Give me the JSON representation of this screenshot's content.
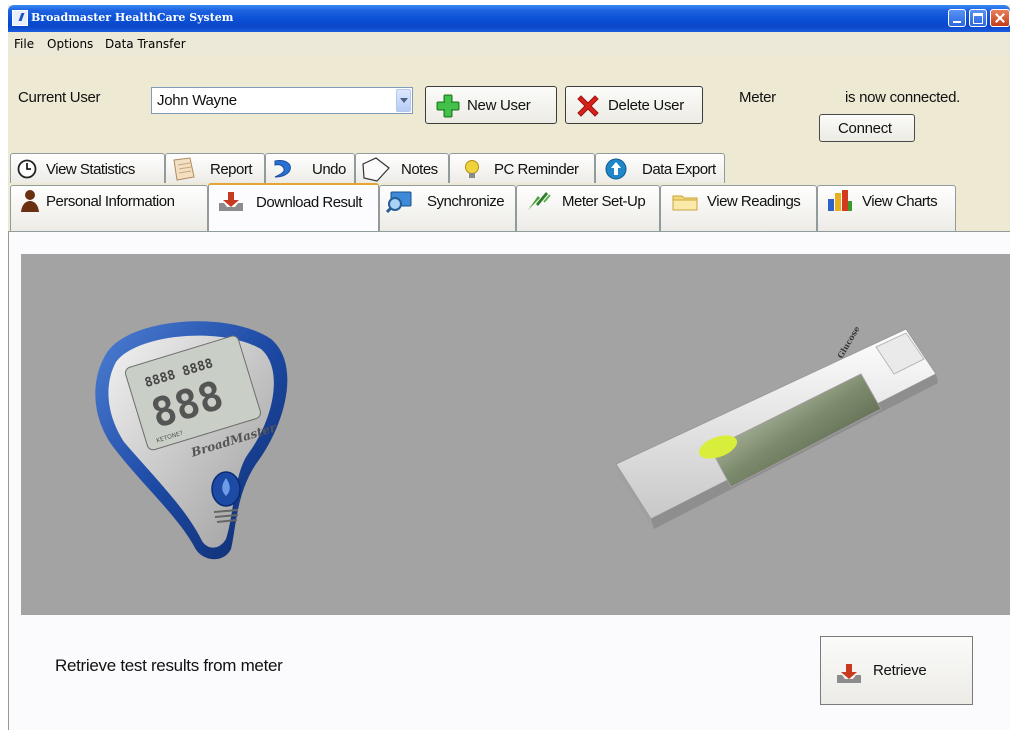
{
  "window": {
    "title": "Broadmaster HealthCare System"
  },
  "menu": [
    "File",
    "Options",
    "Data Transfer"
  ],
  "user_bar": {
    "current_user_label": "Current User",
    "current_user_value": "John Wayne",
    "new_user": "New User",
    "delete_user": "Delete User",
    "meter_label": "Meter",
    "meter_status": "is now connected.",
    "connect": "Connect"
  },
  "tabs_row1": [
    {
      "label": "View Statistics",
      "icon": "clock-icon"
    },
    {
      "label": "Report",
      "icon": "notepad-icon"
    },
    {
      "label": "Undo",
      "icon": "undo-arrow-icon"
    },
    {
      "label": "Notes",
      "icon": "note-page-icon"
    },
    {
      "label": "PC Reminder",
      "icon": "bulb-icon"
    },
    {
      "label": "Data Export",
      "icon": "export-globe-icon"
    }
  ],
  "tabs_row2": [
    {
      "label": "Personal Information",
      "icon": "person-icon"
    },
    {
      "label": "Download Result",
      "icon": "download-tray-icon",
      "active": true
    },
    {
      "label": "Synchronize",
      "icon": "monitor-search-icon"
    },
    {
      "label": "Meter Set-Up",
      "icon": "wrench-icon"
    },
    {
      "label": "View Readings",
      "icon": "folder-icon"
    },
    {
      "label": "View Charts",
      "icon": "bar-chart-icon"
    }
  ],
  "device_images": {
    "meter_brand": "BroadMaster",
    "meter_display": "888",
    "meter_small_digits": "8888 8888",
    "meter_keytone": "KETONE?"
  },
  "download": {
    "instruction": "Retrieve test results from meter",
    "retrieve": "Retrieve"
  },
  "colors": {
    "titlebar": "#0a4fd6",
    "meter_blue": "#1d4aa5",
    "device_panel": "#a3a3a3"
  }
}
